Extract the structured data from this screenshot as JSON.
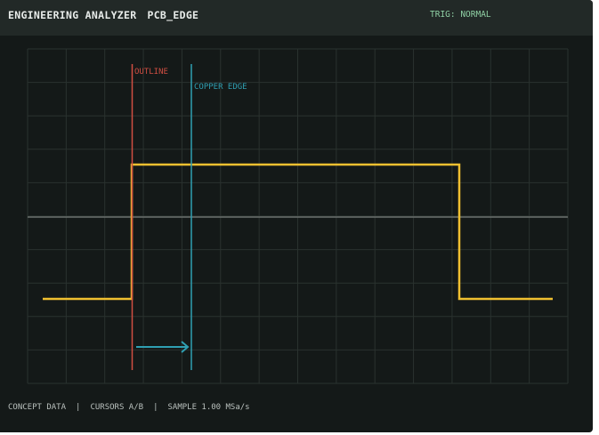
{
  "app": {
    "title": "ENGINEERING ANALYZER",
    "device": "PCB_EDGE",
    "trigger": "TRIG: NORMAL"
  },
  "scope": {
    "markers": [
      {
        "id": "outline",
        "label": "OUTLINE",
        "color": "#d04e42"
      },
      {
        "id": "copper",
        "label": "COPPER EDGE",
        "color": "#2f9fb2"
      }
    ],
    "trace_color": "#f0c030",
    "grid_color": "#2a322f",
    "baseline_color": "#6a706d",
    "arrow_color": "#2f9fb2"
  },
  "status": {
    "data_label": "CONCEPT DATA",
    "cursors_label": "CURSORS A/B",
    "sample_label": "SAMPLE 1.00 MSa/s"
  }
}
